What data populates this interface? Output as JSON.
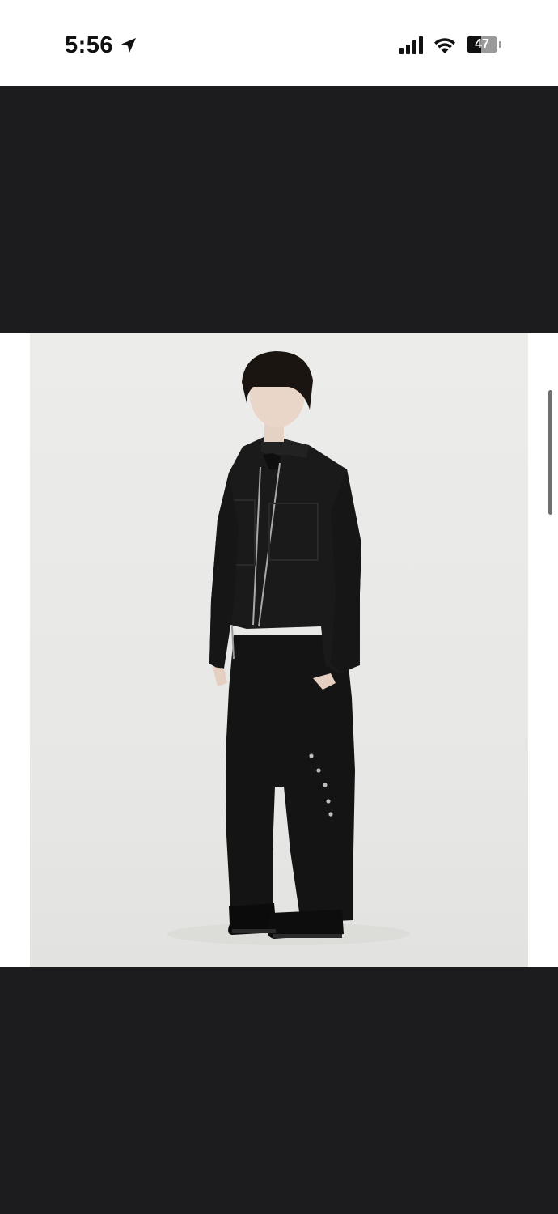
{
  "status_bar": {
    "time": "5:56",
    "battery_percent": "47",
    "battery_level": 0.47,
    "signal_bars": 4,
    "icons": [
      "location-arrow-icon",
      "cellular-signal-icon",
      "wifi-icon",
      "battery-icon"
    ]
  },
  "viewer": {
    "background_color": "#1c1c1e",
    "image": {
      "subject": "model-photo",
      "background_color": "#ebebea"
    }
  }
}
